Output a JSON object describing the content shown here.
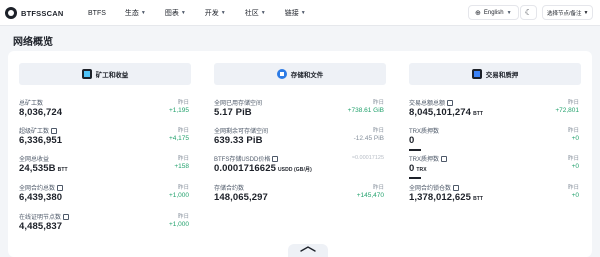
{
  "header": {
    "logo_text": "BTFSSCAN",
    "nav": [
      "BTFS",
      "生态",
      "图表",
      "开发",
      "社区",
      "链接"
    ],
    "language": "English",
    "network": "选择节点/备注"
  },
  "page_title": "网络概览",
  "columns": [
    {
      "title": "矿工和收益",
      "icon": "miner-icon",
      "metrics": [
        {
          "label": "总矿工数",
          "value": "8,036,724",
          "unit": "",
          "yesterday": "昨日",
          "change": "+1,195",
          "info": false
        },
        {
          "label": "超级矿工数",
          "value": "6,336,951",
          "unit": "",
          "yesterday": "昨日",
          "change": "+4,175",
          "info": true
        },
        {
          "label": "全网总收益",
          "value": "24,535B",
          "unit": "BTT",
          "yesterday": "昨日",
          "change": "+158",
          "info": false
        },
        {
          "label": "全网合约总数",
          "value": "6,439,380",
          "unit": "",
          "yesterday": "昨日",
          "change": "+1,000",
          "info": true
        },
        {
          "label": "在线证明节点数",
          "value": "4,485,837",
          "unit": "",
          "yesterday": "昨日",
          "change": "+1,000",
          "info": true
        }
      ]
    },
    {
      "title": "存储和文件",
      "icon": "storage-icon",
      "metrics": [
        {
          "label": "全网已用存储空间",
          "value": "5.17 PiB",
          "unit": "",
          "yesterday": "昨日",
          "change": "+738.61 GiB",
          "info": false
        },
        {
          "label": "全网剩余可存储空间",
          "value": "639.33 PiB",
          "unit": "",
          "yesterday": "昨日",
          "change": "-12.45 PiB",
          "info": false
        },
        {
          "label": "BTFS存储USDD价格",
          "value": "0.0001716625",
          "unit": "USDD (GB/月)",
          "yesterday": "",
          "change": "≈0.00017125",
          "info": true
        },
        {
          "label": "存储合约数",
          "value": "148,065,297",
          "unit": "",
          "yesterday": "昨日",
          "change": "+145,470",
          "info": false
        }
      ]
    },
    {
      "title": "交易和质押",
      "icon": "trade-icon",
      "metrics": [
        {
          "label": "交易总额总额",
          "value": "8,045,101,274",
          "unit": "BTT",
          "yesterday": "昨日",
          "change": "+72,801",
          "info": true
        },
        {
          "label": "TRX质押数",
          "value": "0",
          "unit": "",
          "yesterday": "昨日",
          "change": "+0",
          "info": false,
          "progress": 0.2
        },
        {
          "label": "TRX质押数",
          "value": "0",
          "unit": "TRX",
          "yesterday": "昨日",
          "change": "+0",
          "info": true,
          "progress": 0.2
        },
        {
          "label": "全网合约锁仓数",
          "value": "1,378,012,625",
          "unit": "BTT",
          "yesterday": "昨日",
          "change": "+0",
          "info": true
        }
      ]
    }
  ]
}
